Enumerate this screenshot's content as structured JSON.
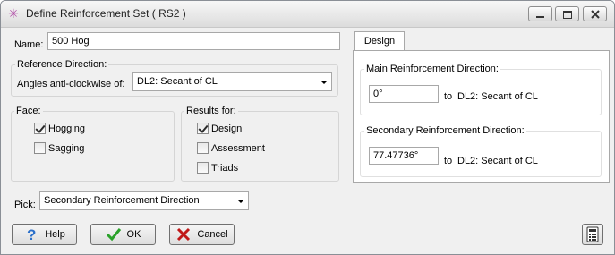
{
  "window": {
    "title": "Define Reinforcement Set ( RS2 )",
    "icons": {
      "app": "reinforcement-set-icon",
      "minimize": "minimize-icon",
      "maximize": "maximize-icon",
      "close": "close-icon"
    }
  },
  "name": {
    "label": "Name:",
    "value": "500 Hog"
  },
  "reference_direction": {
    "title": "Reference Direction:",
    "angles_label": "Angles anti-clockwise of:",
    "selected": "DL2: Secant of CL"
  },
  "face": {
    "title": "Face:",
    "options": [
      {
        "label": "Hogging",
        "checked": true
      },
      {
        "label": "Sagging",
        "checked": false
      }
    ]
  },
  "results_for": {
    "title": "Results for:",
    "options": [
      {
        "label": "Design",
        "checked": true
      },
      {
        "label": "Assessment",
        "checked": false
      },
      {
        "label": "Triads",
        "checked": false
      }
    ]
  },
  "pick": {
    "label": "Pick:",
    "selected": "Secondary Reinforcement Direction"
  },
  "tabs": [
    {
      "label": "Design",
      "active": true
    }
  ],
  "design": {
    "main": {
      "title": "Main Reinforcement Direction:",
      "value": "0°",
      "to_label": "to",
      "ref": "DL2: Secant of CL"
    },
    "secondary": {
      "title": "Secondary Reinforcement Direction:",
      "value": "77.47736°",
      "to_label": "to",
      "ref": "DL2: Secant of CL"
    }
  },
  "buttons": {
    "help": "Help",
    "ok": "OK",
    "cancel": "Cancel",
    "calculator_icon": "calculator-icon"
  },
  "colors": {
    "ok_check": "#2aa12a",
    "cancel_x": "#c01818",
    "help_q": "#2a6fc9"
  }
}
